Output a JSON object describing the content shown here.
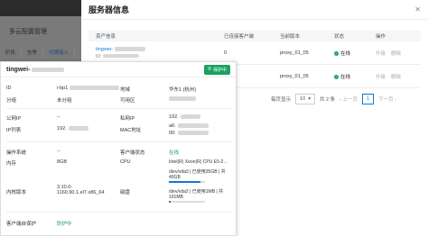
{
  "background": {
    "app_title": "多云配置管理",
    "tabs": [
      "阶段",
      "告警",
      "代理接入"
    ]
  },
  "panel": {
    "title": "服务器信息",
    "columns": [
      "资产信息",
      "已连接客户端",
      "当前版本",
      "状态",
      "操作"
    ],
    "rows": [
      {
        "asset_name": "tingwei-",
        "asset_sub": "ID:",
        "clients": "0",
        "version": "proxy_01_05",
        "status": "在线",
        "actions": [
          "升级",
          "删除"
        ]
      },
      {
        "asset_name": "",
        "asset_sub": "",
        "clients": "0",
        "version": "proxy_01_05",
        "status": "在线",
        "actions": [
          "升级",
          "删除"
        ]
      }
    ],
    "pager": {
      "page_size": "10",
      "total": "共 2 条",
      "prev": "上一页",
      "current": "1",
      "next": "下一页",
      "page_size_label": "每页显示"
    }
  },
  "popup": {
    "host": "tingwei-",
    "badge": "保护中",
    "fields": {
      "id_label": "ID",
      "id_value": "i-bp1",
      "region_label": "地域",
      "region_value": "华东1 (杭州)",
      "group_label": "分组",
      "group_value": "未分组",
      "zone_label": "可用区",
      "zone_value": "",
      "public_ip_label": "公网IP",
      "public_ip_value": "--",
      "private_ip_label": "私网IP",
      "private_ip_value": "192.",
      "ip_list_label": "IP列表",
      "ip_list_value": "192.",
      "mac_label": "MAC地址",
      "mac_value": "a6:",
      "mac_value2": "00:",
      "os_label": "操作系统",
      "os_value": "--",
      "client_status_label": "客户端状态",
      "client_status_value": "在线",
      "mem_label": "内存",
      "mem_value": "8GB",
      "cpu_label": "CPU",
      "cpu_value": "Intel(R) Xeon(R) CPU E5-2...",
      "disk1": "/dev/vda3 | 已使用35GB | 共40GB",
      "disk1_pct": 0.88,
      "kernel_label": "内核版本",
      "kernel_value": "3.10.0-1160.90.1.el7.x86_64",
      "disk_label": "磁盘",
      "disk2": "/dev/vda2 | 已使用1MB | 共191MB",
      "disk2_pct": 0.05,
      "protect_label": "客户端自保护",
      "protect_value": "防护中"
    }
  }
}
